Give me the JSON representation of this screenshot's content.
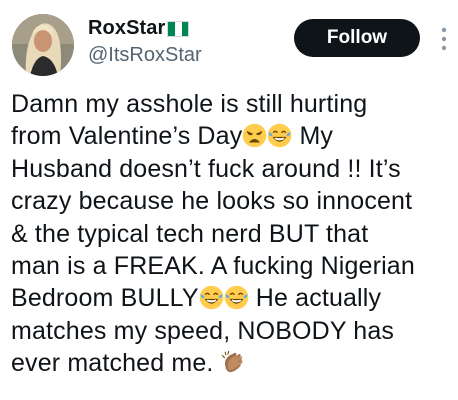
{
  "author": {
    "display_name": "RoxStar",
    "handle": "@ItsRoxStar",
    "flag_icon": "nigeria-flag-icon",
    "flag_colors": [
      "#008751",
      "#ffffff",
      "#008751"
    ]
  },
  "follow_button": {
    "label": "Follow"
  },
  "more_icon": "more-options-icon",
  "tweet": {
    "lines": [
      [
        "Damn my asshole is still hurting"
      ],
      [
        "from Valentine’s Day",
        " My"
      ],
      [
        "Husband doesn’t fuck around !! It’s"
      ],
      [
        "crazy because he looks so innocent"
      ],
      [
        "& the typical tech nerd BUT that"
      ],
      [
        "man is a FREAK. A fucking Nigerian"
      ],
      [
        "Bedroom BULLY",
        " He actually"
      ],
      [
        "matches my speed, NOBODY has"
      ],
      [
        "ever matched me. "
      ]
    ],
    "emojis": {
      "line2": [
        "weary-face-icon",
        "tears-of-joy-icon"
      ],
      "line7": [
        "tears-of-joy-icon",
        "tears-of-joy-icon"
      ],
      "line9": [
        "clapping-hands-icon"
      ]
    }
  },
  "colors": {
    "text": "#0f1419",
    "handle": "#536471",
    "button_bg": "#0f1419",
    "button_text": "#ffffff"
  }
}
